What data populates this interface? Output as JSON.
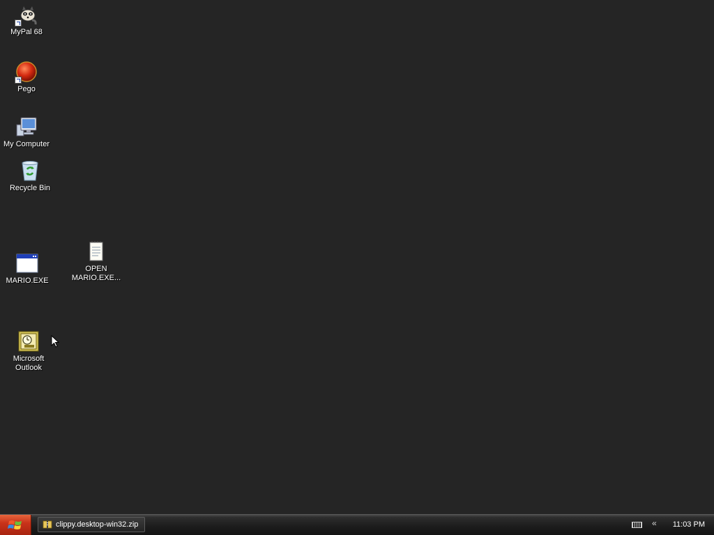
{
  "desktop": {
    "icons": [
      {
        "label": "MyPal 68",
        "icon": "mypal-raccoon-icon",
        "shortcut": true
      },
      {
        "label": "Pego",
        "icon": "pego-red-ball-icon",
        "shortcut": true
      },
      {
        "label": "My Computer",
        "icon": "my-computer-icon",
        "shortcut": false
      },
      {
        "label": "Recycle Bin",
        "icon": "recycle-bin-icon",
        "shortcut": false
      },
      {
        "label": "MARIO.EXE",
        "icon": "application-window-icon",
        "shortcut": false
      },
      {
        "label": "OPEN\nMARIO.EXE...",
        "icon": "text-document-icon",
        "shortcut": false
      },
      {
        "label": "Microsoft\nOutlook",
        "icon": "outlook-icon",
        "shortcut": false
      }
    ]
  },
  "taskbar": {
    "start_icon": "windows-logo-icon",
    "task_button": {
      "label": "clippy.desktop-win32.zip",
      "icon": "zip-folder-icon"
    },
    "tray": {
      "keyboard_icon": "keyboard-icon",
      "expand_glyph": "«",
      "clock": "11:03 PM"
    }
  },
  "colors": {
    "desktop_background": "#252525",
    "start_button": "#c9331a",
    "taskbar": "#1d1d1d"
  }
}
